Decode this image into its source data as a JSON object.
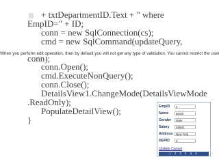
{
  "code": {
    "lines": [
      "+ txtDepartmentID.Text + \" where",
      "EmpID=\" + ID;",
      "conn = new SqlConnection(cs);",
      "cmd = new SqlCommand(updateQuery,",
      "conn);",
      "conn.Open();",
      "cmd.ExecuteNonQuery();",
      "conn.Close();",
      "DetailsView1.ChangeMode(DetailsViewMode",
      ".ReadOnly);",
      "PopulateDetailView();",
      "}"
    ]
  },
  "tooltip": {
    "text": "When you perform edit operation, then by default you will not get any type of validation. You cannot restrict the user to enter null"
  },
  "details_view": {
    "rows": [
      {
        "label": "EmpID",
        "value": "2"
      },
      {
        "label": "Name",
        "value": "Debjit"
      },
      {
        "label": "Gender",
        "value": "Male"
      },
      {
        "label": "Salary",
        "value": "45000"
      },
      {
        "label": "Address",
        "value": "New York"
      },
      {
        "label": "DEPID",
        "value": "3"
      }
    ],
    "update_link": "Update",
    "cancel_link": "Cancel",
    "pager": "1 2 3 4 5 6"
  },
  "colors": {
    "code_text": "#3f3f3f",
    "detailsview_border": "#9fb3c8",
    "pager_background": "#2f4f8a",
    "link": "#1a1a8c"
  }
}
